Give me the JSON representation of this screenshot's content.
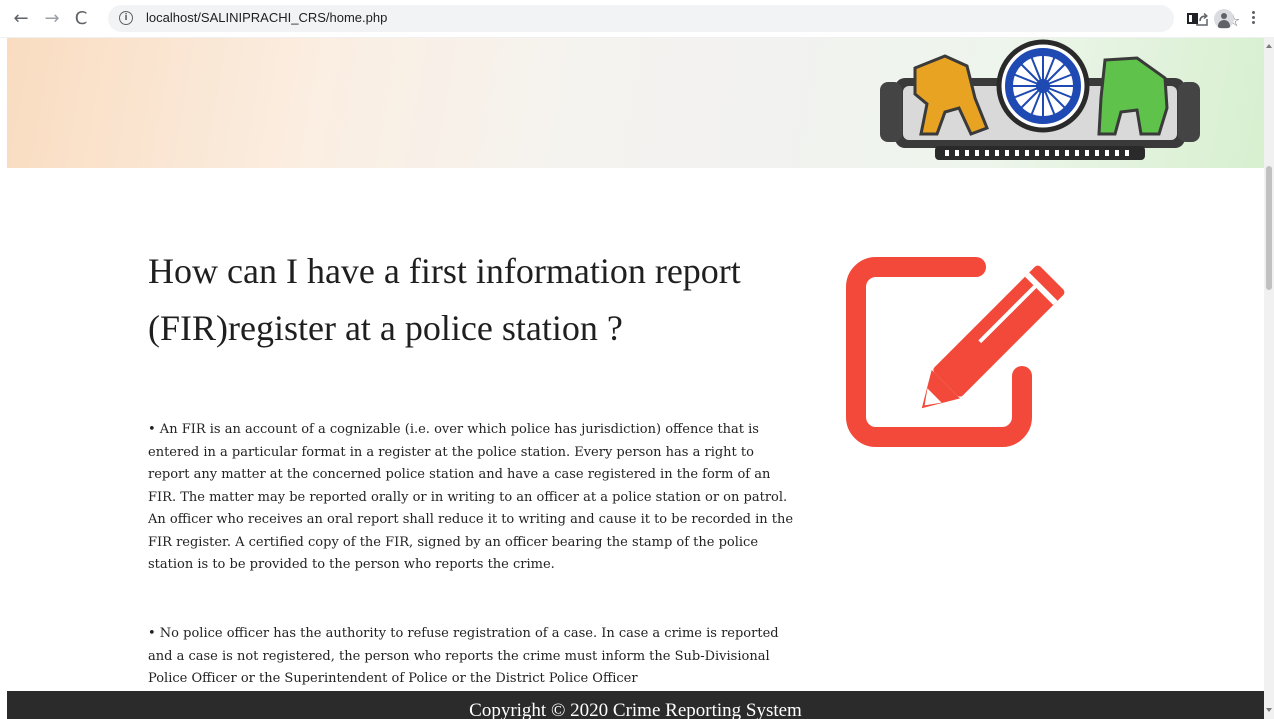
{
  "browser": {
    "url": "localhost/SALINIPRACHI_CRS/home.php",
    "back_glyph": "←",
    "forward_glyph": "→",
    "reload_glyph": "C",
    "info_glyph": "i",
    "star_glyph": "☆"
  },
  "content": {
    "heading": "How can I have a first information report (FIR)register at a police station ?",
    "paragraphs": [
      "•  An FIR is an account of a cognizable (i.e. over which police has jurisdiction) offence that is entered in a particular format in a register at the police station. Every person has a right to report any matter at the concerned police station and have a case registered in the form of an FIR. The matter may be reported orally or in writing to an officer at a police station or on patrol. An officer who receives an oral report shall reduce it to writing and cause it to be recorded in the FIR register. A certified copy of the FIR, signed by an officer bearing the stamp of the police station is to be provided to the person who reports the crime.",
      "•  No police officer has the authority to refuse registration of a case. In case a crime is reported and a case is not registered, the person who reports the crime must inform the Sub-Divisional Police Officer or the Superintendent of Police or the District Police Officer"
    ]
  },
  "footer": {
    "text": "Copyright © 2020 Crime Reporting System"
  },
  "colors": {
    "edit_icon": "#f2493a",
    "footer_bg": "#2b2b2b"
  },
  "icons": {
    "edit": "edit-pencil-icon",
    "emblem": "emblem-icon"
  }
}
